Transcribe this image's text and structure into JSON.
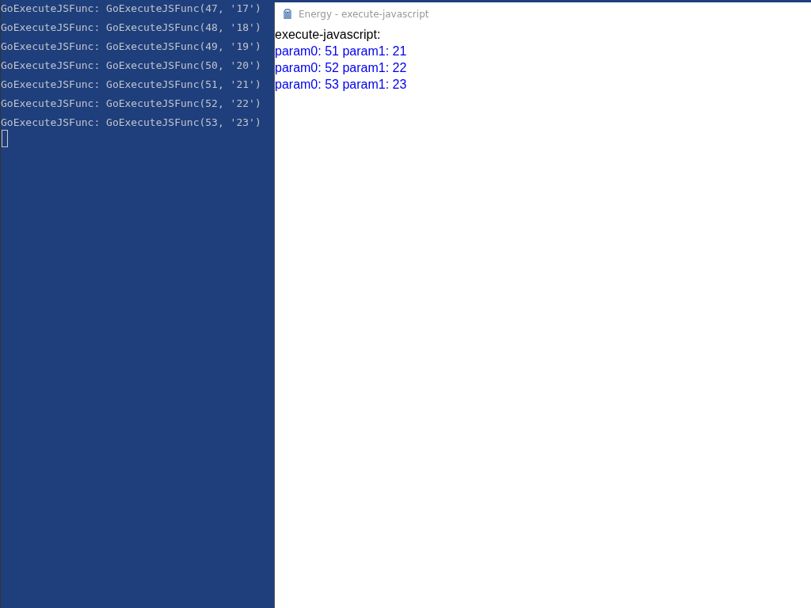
{
  "console": {
    "lines": [
      "GoExecuteJSFunc: GoExecuteJSFunc(47, '17')",
      "GoExecuteJSFunc: GoExecuteJSFunc(48, '18')",
      "GoExecuteJSFunc: GoExecuteJSFunc(49, '19')",
      "GoExecuteJSFunc: GoExecuteJSFunc(50, '20')",
      "GoExecuteJSFunc: GoExecuteJSFunc(51, '21')",
      "GoExecuteJSFunc: GoExecuteJSFunc(52, '22')",
      "GoExecuteJSFunc: GoExecuteJSFunc(53, '23')"
    ]
  },
  "window": {
    "title": "Energy - execute-javascript",
    "heading": "execute-javascript:",
    "results": [
      "param0: 51 param1: 21",
      "param0: 52 param1: 22",
      "param0: 53 param1: 23"
    ]
  }
}
